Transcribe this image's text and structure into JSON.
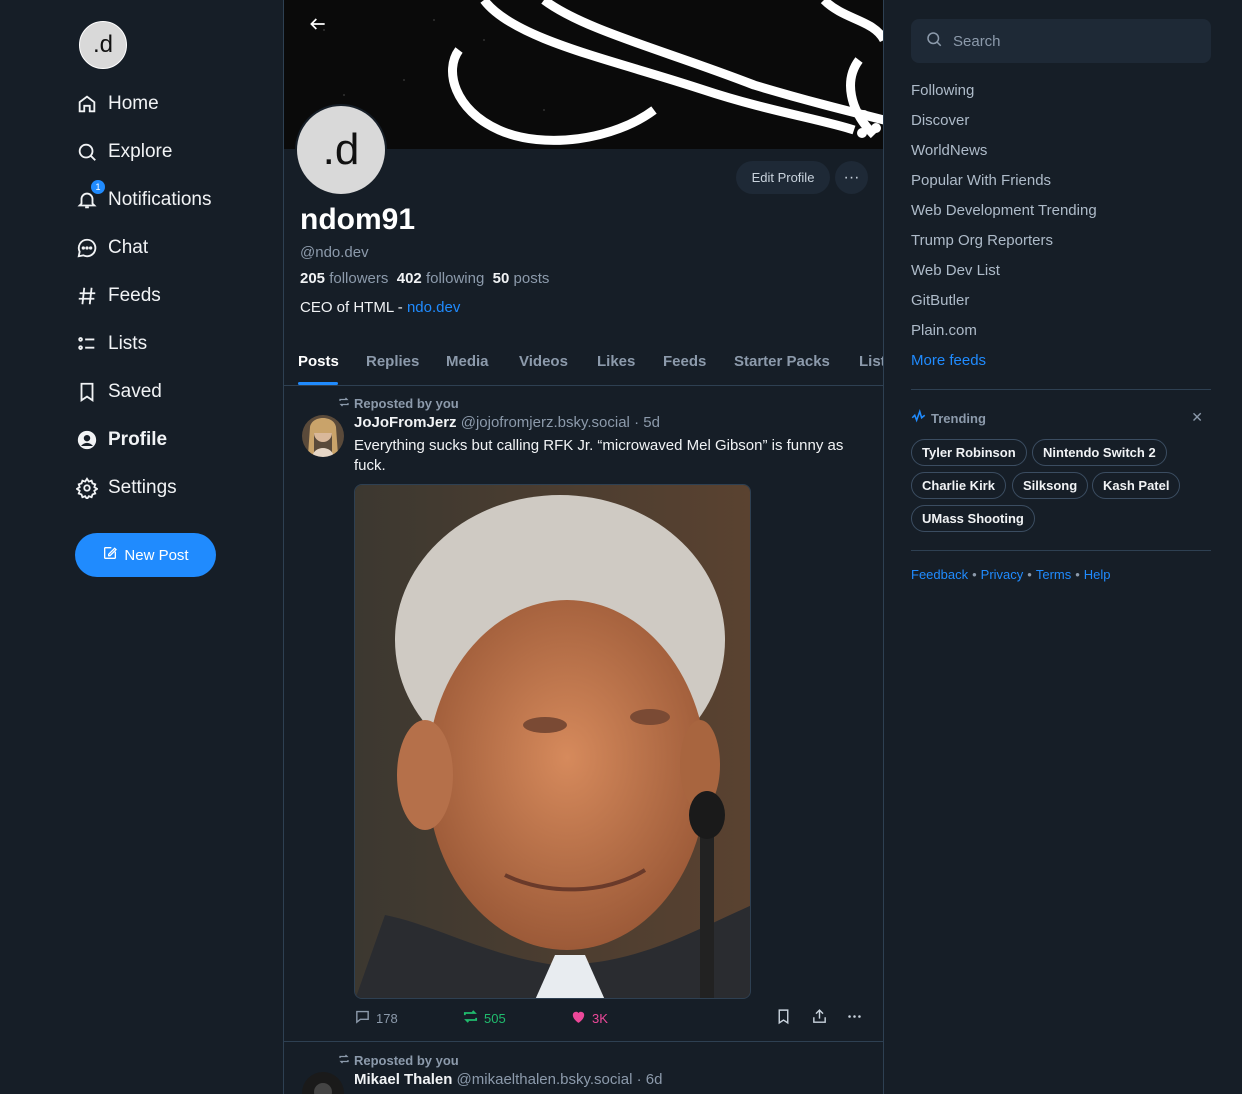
{
  "brand": {
    "logo_text": ".d",
    "accent": "#208bfe",
    "bg": "#161e27"
  },
  "nav": {
    "items": [
      {
        "label": "Home",
        "icon": "home-icon"
      },
      {
        "label": "Explore",
        "icon": "search-icon"
      },
      {
        "label": "Notifications",
        "icon": "bell-icon",
        "badge": "1"
      },
      {
        "label": "Chat",
        "icon": "chat-icon"
      },
      {
        "label": "Feeds",
        "icon": "hash-icon"
      },
      {
        "label": "Lists",
        "icon": "list-icon"
      },
      {
        "label": "Saved",
        "icon": "bookmark-icon"
      },
      {
        "label": "Profile",
        "icon": "profile-icon",
        "active": true
      },
      {
        "label": "Settings",
        "icon": "gear-icon"
      }
    ],
    "new_post_label": "New Post"
  },
  "profile": {
    "avatar_text": ".d",
    "display_name": "ndom91",
    "handle": "@ndo.dev",
    "followers_count": "205",
    "followers_label": "followers",
    "following_count": "402",
    "following_label": "following",
    "posts_count": "50",
    "posts_label": "posts",
    "bio_text": "CEO of HTML - ",
    "bio_link": "ndo.dev",
    "edit_label": "Edit Profile",
    "more_label": "···"
  },
  "tabs": [
    "Posts",
    "Replies",
    "Media",
    "Videos",
    "Likes",
    "Feeds",
    "Starter Packs",
    "Lists"
  ],
  "posts": [
    {
      "repost_label": "Reposted by you",
      "author": "JoJoFromJerz",
      "handle": "@jojofromjerz.bsky.social",
      "time": "· 5d",
      "text": "Everything sucks but calling RFK Jr. “microwaved Mel Gibson” is funny as fuck.",
      "replies": "178",
      "reposts": "505",
      "likes": "3K"
    },
    {
      "repost_label": "Reposted by you",
      "author": "Mikael Thalen",
      "handle": "@mikaelthalen.bsky.social",
      "time": "· 6d"
    }
  ],
  "sidebar": {
    "search_placeholder": "Search",
    "feeds": [
      "Following",
      "Discover",
      "WorldNews",
      "Popular With Friends",
      "Web Development Trending",
      "Trump Org Reporters",
      "Web Dev List",
      "GitButler",
      "Plain.com"
    ],
    "more_feeds": "More feeds",
    "trending_title": "Trending",
    "trending": [
      "Tyler Robinson",
      "Nintendo Switch 2",
      "Charlie Kirk",
      "Silksong",
      "Kash Patel",
      "UMass Shooting"
    ],
    "footer": [
      "Feedback",
      "Privacy",
      "Terms",
      "Help"
    ]
  }
}
